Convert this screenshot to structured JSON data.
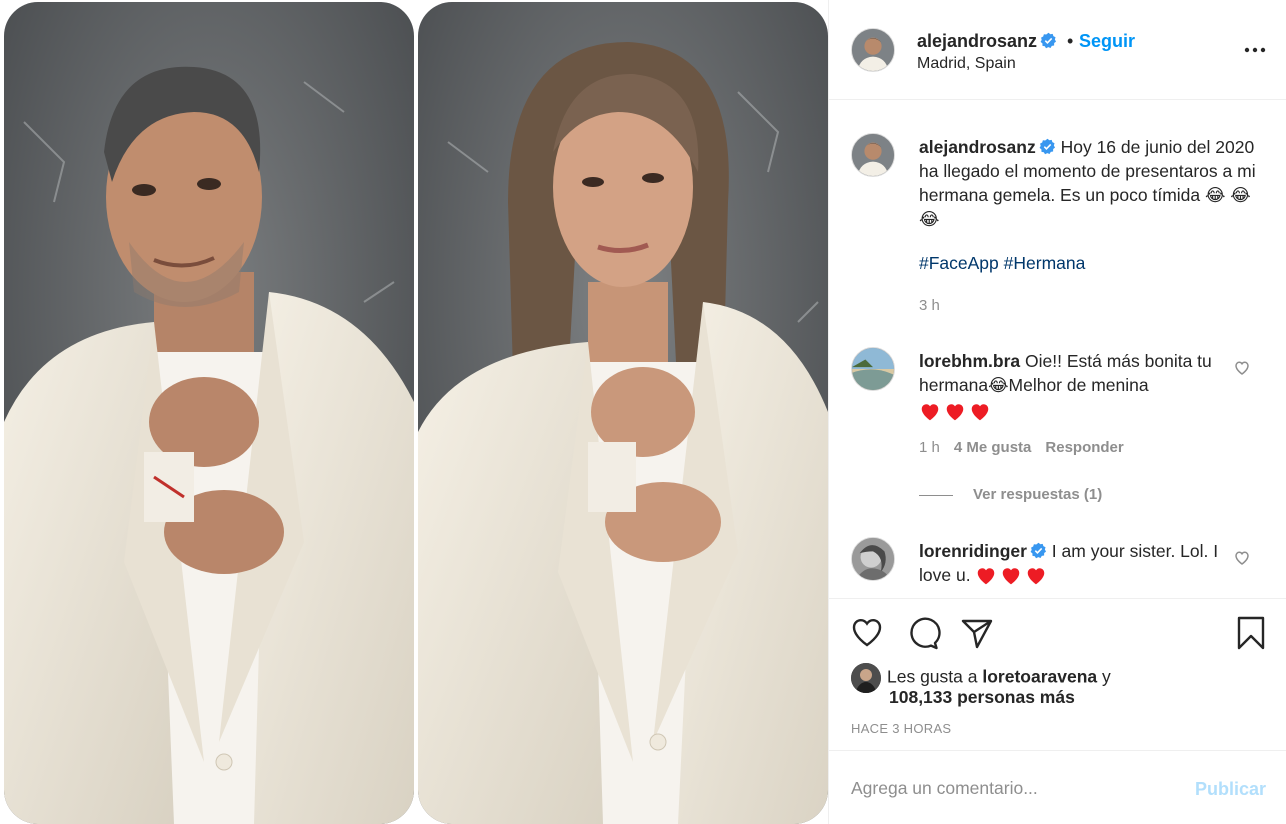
{
  "post": {
    "images": [
      {
        "subject": "man-in-white-suit"
      },
      {
        "subject": "woman-in-white-suit"
      }
    ]
  },
  "header": {
    "username": "alejandrosanz",
    "separator": "•",
    "follow_label": "Seguir",
    "location": "Madrid, Spain"
  },
  "caption": {
    "username": "alejandrosanz",
    "text": " Hoy 16 de junio del 2020 ha llegado el momento de presentaros a mi hermana gemela. Es un poco tímida 😂 😂 😂",
    "hashtags": [
      "#FaceApp",
      "#Hermana"
    ],
    "time": "3 h"
  },
  "comments": [
    {
      "username": "lorebhm.bra",
      "text": " Oie!! Está más bonita tu hermana😂Melhor de menina",
      "hearts": 3,
      "time": "1 h",
      "likes": "4 Me gusta",
      "reply_label": "Responder",
      "view_replies": "Ver respuestas (1)"
    },
    {
      "username": "lorenridinger",
      "verified": true,
      "text": " I am your sister. Lol. I love u.",
      "hearts": 3
    }
  ],
  "actions": {
    "liked_by_prefix": "Les gusta a ",
    "liked_by_user": "loretoaravena",
    "liked_by_suffix": " y",
    "others_count": "108,133 personas más",
    "time_ago": "HACE 3 HORAS"
  },
  "comment_box": {
    "placeholder": "Agrega un comentario...",
    "publish_label": "Publicar"
  },
  "colors": {
    "link_blue": "#0095f6",
    "hashtag_blue": "#00376b",
    "muted_gray": "#8e8e8e",
    "heart_red": "#ed1c24",
    "publish_disabled": "#b2dffc"
  },
  "icons": {
    "more": "more-options-icon",
    "like": "heart-outline-icon",
    "comment": "comment-bubble-icon",
    "share": "paper-plane-icon",
    "save": "bookmark-icon",
    "verified": "verified-badge-icon"
  }
}
